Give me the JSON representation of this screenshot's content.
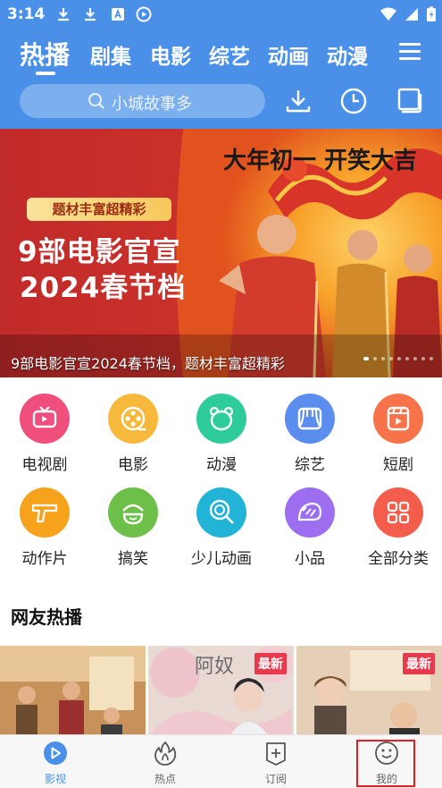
{
  "status": {
    "time": "3:14"
  },
  "tabs": [
    {
      "label": "热播",
      "active": true
    },
    {
      "label": "剧集"
    },
    {
      "label": "电影"
    },
    {
      "label": "综艺"
    },
    {
      "label": "动画"
    },
    {
      "label": "动漫"
    }
  ],
  "search": {
    "placeholder": "小城故事多"
  },
  "banner": {
    "tag": "题材丰富超精彩",
    "headline_1": "9部电影官宣",
    "headline_2": "2024春节档",
    "poster_text": "大年初一 开笑大吉",
    "caption": "9部电影官宣2024春节档，题材丰富超精彩"
  },
  "categories": [
    {
      "label": "电视剧",
      "icon": "tv-icon",
      "color": "#f04e7c"
    },
    {
      "label": "电影",
      "icon": "film-reel-icon",
      "color": "#f6b93b"
    },
    {
      "label": "动漫",
      "icon": "bear-icon",
      "color": "#2ecc9a"
    },
    {
      "label": "综艺",
      "icon": "stage-curtain-icon",
      "color": "#5b8def"
    },
    {
      "label": "短剧",
      "icon": "short-video-icon",
      "color": "#f7744a"
    },
    {
      "label": "动作片",
      "icon": "gun-icon",
      "color": "#f7a21b"
    },
    {
      "label": "搞笑",
      "icon": "smile-face-icon",
      "color": "#6cc04a"
    },
    {
      "label": "少儿动画",
      "icon": "lollipop-icon",
      "color": "#21b4d6"
    },
    {
      "label": "小品",
      "icon": "hedgehog-icon",
      "color": "#9d6ef0"
    },
    {
      "label": "全部分类",
      "icon": "grid-icon",
      "color": "#f45d4c"
    }
  ],
  "section": {
    "title": "网友热播"
  },
  "thumbs": [
    {
      "badge": ""
    },
    {
      "badge": "最新",
      "poster_text": "阿奴"
    },
    {
      "badge": "最新"
    }
  ],
  "bottom_nav": [
    {
      "label": "影视",
      "icon": "play-icon",
      "active": true
    },
    {
      "label": "热点",
      "icon": "fire-icon"
    },
    {
      "label": "订阅",
      "icon": "subscribe-plus-icon"
    },
    {
      "label": "我的",
      "icon": "smiley-icon"
    }
  ],
  "colors": {
    "primary": "#4a90e8",
    "badge": "#e8394d",
    "highlight": "#e02020"
  }
}
